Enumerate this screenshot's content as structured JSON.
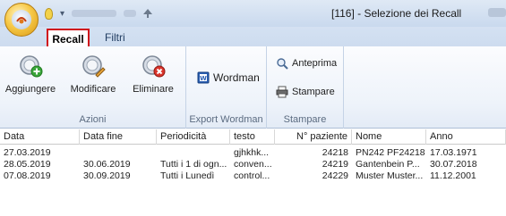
{
  "window": {
    "title": "[116] - Selezione dei Recall"
  },
  "tabs": [
    {
      "label": "Recall"
    },
    {
      "label": "Filtri"
    }
  ],
  "ribbon": {
    "groups": [
      {
        "label": "Azioni",
        "buttons": [
          {
            "label": "Aggiungere",
            "icon": "add-recall-icon"
          },
          {
            "label": "Modificare",
            "icon": "edit-recall-icon"
          },
          {
            "label": "Eliminare",
            "icon": "delete-recall-icon"
          }
        ]
      },
      {
        "label": "Export Wordman",
        "buttons": [
          {
            "label": "Wordman",
            "icon": "word-document-icon"
          }
        ]
      },
      {
        "label": "Stampare",
        "buttons": [
          {
            "label": "Anteprima",
            "icon": "print-preview-icon"
          },
          {
            "label": "Stampare",
            "icon": "printer-icon"
          }
        ]
      }
    ]
  },
  "grid": {
    "columns": [
      "Data",
      "Data fine",
      "Periodicità",
      "testo",
      "N° paziente",
      "Nome",
      "Anno"
    ],
    "rows": [
      [
        "27.03.2019",
        "",
        "",
        "gjhkhk...",
        "24218",
        "PN242 PF24218",
        "17.03.1971"
      ],
      [
        "28.05.2019",
        "30.06.2019",
        "Tutti i 1 di ogn...",
        "conven...",
        "24219",
        "Gantenbein P...",
        "30.07.2018"
      ],
      [
        "07.08.2019",
        "30.09.2019",
        "Tutti i Lunedì",
        "control...",
        "24229",
        "Muster Muster...",
        "11.12.2001"
      ]
    ]
  },
  "colors": {
    "active_tab_border": "#d0101a",
    "ribbon_bg": "#eef3fa",
    "titlebar_bg": "#c9d9ee"
  }
}
